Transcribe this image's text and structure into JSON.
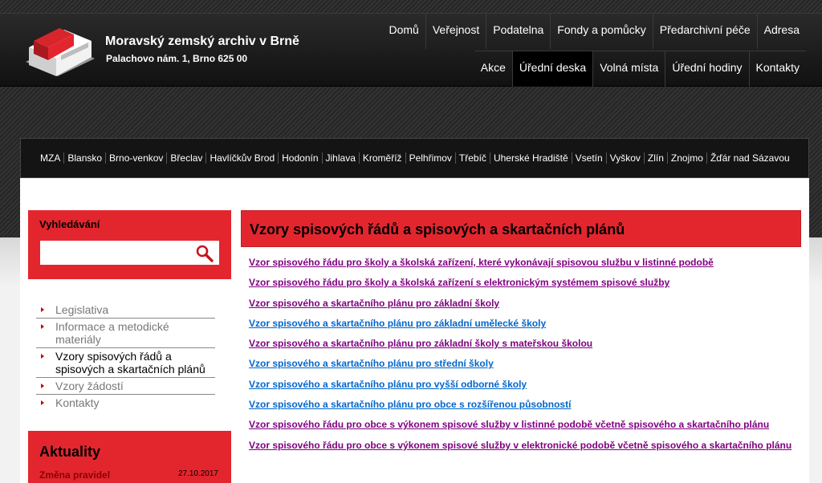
{
  "site": {
    "title": "Moravský zemský archiv v Brně",
    "address": "Palachovo nám. 1, Brno 625 00"
  },
  "topnav": {
    "row1": [
      "Domů",
      "Veřejnost",
      "Podatelna",
      "Fondy a pomůcky",
      "Předarchivní péče",
      "Adresa"
    ],
    "row2": [
      "Akce",
      "Úřední deska",
      "Volná místa",
      "Úřední hodiny",
      "Kontakty"
    ],
    "active": "Úřední deska"
  },
  "branches": [
    "MZA",
    "Blansko",
    "Brno-venkov",
    "Břeclav",
    "Havlíčkův Brod",
    "Hodonín",
    "Jihlava",
    "Kroměříž",
    "Pelhřimov",
    "Třebíč",
    "Uherské Hradiště",
    "Vsetín",
    "Vyškov",
    "Zlín",
    "Znojmo",
    "Žďár nad Sázavou"
  ],
  "search": {
    "title": "Vyhledávání",
    "placeholder": "",
    "icon": "search-icon"
  },
  "sidemenu": [
    {
      "label": "Legislativa",
      "active": false
    },
    {
      "label": "Informace a metodické materiály",
      "active": false
    },
    {
      "label": "Vzory spisových řádů a spisových a skartačních plánů",
      "active": true
    },
    {
      "label": "Vzory žádostí",
      "active": false
    },
    {
      "label": "Kontakty",
      "active": false
    }
  ],
  "news": {
    "title": "Aktuality",
    "items": [
      {
        "label": "Změna pravidel",
        "date": "27.10.2017"
      }
    ]
  },
  "main": {
    "heading": "Vzory spisových řádů a spisových a skartačních plánů",
    "links": [
      {
        "label": "Vzor spisového řádu pro školy a školská zařízení, které vykonávají spisovou službu v listinné podobě",
        "visited": true
      },
      {
        "label": "Vzor spisového řádu pro školy a školská zařízení s elektronickým systémem spisové služby",
        "visited": true
      },
      {
        "label": "Vzor spisového a skartačního plánu pro základní školy",
        "visited": true
      },
      {
        "label": "Vzor spisového a skartačního plánu pro základní umělecké školy",
        "visited": false
      },
      {
        "label": "Vzor spisového a skartačního plánu pro základní školy s mateřskou školou",
        "visited": true
      },
      {
        "label": "Vzor spisového a skartačního plánu pro střední školy",
        "visited": false
      },
      {
        "label": "Vzor spisového a skartačního plánu pro vyšší odborné školy",
        "visited": false
      },
      {
        "label": "Vzor spisového a skartačního plánu pro obce s rozšířenou působností",
        "visited": false
      },
      {
        "label": "Vzor spisového řádu pro obce s výkonem spisové služby v listinné podobě včetně spisového a skartačního plánu",
        "visited": true
      },
      {
        "label": "Vzor spisového řádu pro obce s výkonem spisové služby v elektronické podobě včetně spisového a skartačního plánu",
        "visited": true
      }
    ]
  },
  "colors": {
    "accent": "#e3262e",
    "link": "#0066cc",
    "visited": "#800080"
  }
}
